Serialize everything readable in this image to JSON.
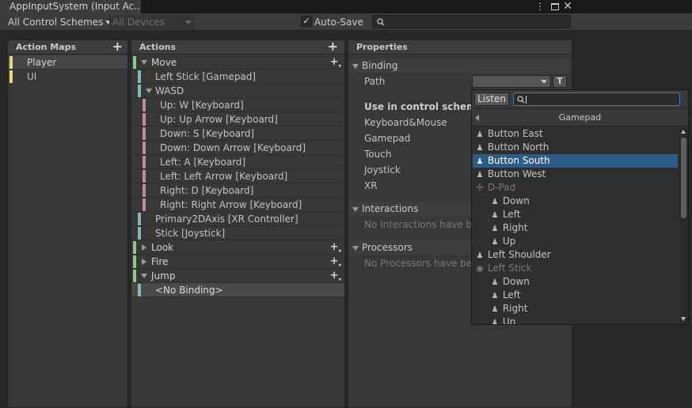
{
  "window": {
    "title": "AppInputSystem (Input Ac...",
    "menu_icon": "kebab-menu-icon",
    "maximize_icon": "maximize-icon",
    "close_icon": "close-icon"
  },
  "toolbar": {
    "control_schemes": "All Control Schemes",
    "devices": "All Devices",
    "autosave_checked": true,
    "autosave_label": "Auto-Save",
    "search_placeholder": ""
  },
  "action_maps": {
    "header": "Action Maps",
    "items": [
      {
        "label": "Player",
        "selected": true
      },
      {
        "label": "UI",
        "selected": false
      }
    ]
  },
  "actions": {
    "header": "Actions",
    "rows": [
      {
        "label": "Move",
        "kind": "action",
        "expanded": true
      },
      {
        "label": "Left Stick [Gamepad]",
        "kind": "binding"
      },
      {
        "label": "WASD",
        "kind": "composite",
        "expanded": true
      },
      {
        "label": "Up: W [Keyboard]",
        "kind": "part"
      },
      {
        "label": "Up: Up Arrow [Keyboard]",
        "kind": "part"
      },
      {
        "label": "Down: S [Keyboard]",
        "kind": "part"
      },
      {
        "label": "Down: Down Arrow [Keyboard]",
        "kind": "part"
      },
      {
        "label": "Left: A [Keyboard]",
        "kind": "part"
      },
      {
        "label": "Left: Left Arrow [Keyboard]",
        "kind": "part"
      },
      {
        "label": "Right: D [Keyboard]",
        "kind": "part"
      },
      {
        "label": "Right: Right Arrow [Keyboard]",
        "kind": "part"
      },
      {
        "label": "Primary2DAxis [XR Controller]",
        "kind": "binding"
      },
      {
        "label": "Stick [Joystick]",
        "kind": "binding"
      },
      {
        "label": "Look",
        "kind": "action",
        "expanded": false
      },
      {
        "label": "Fire",
        "kind": "action",
        "expanded": false
      },
      {
        "label": "Jump",
        "kind": "action",
        "expanded": true
      },
      {
        "label": "<No Binding>",
        "kind": "binding",
        "selected": true
      }
    ]
  },
  "properties": {
    "header": "Properties",
    "binding_section": "Binding",
    "path_label": "Path",
    "t_button": "T",
    "use_in_scheme": "Use in control scheme",
    "schemes": [
      "Keyboard&Mouse",
      "Gamepad",
      "Touch",
      "Joystick",
      "XR"
    ],
    "interactions_section": "Interactions",
    "interactions_empty": "No Interactions have bee",
    "processors_section": "Processors",
    "processors_empty": "No Processors have bee"
  },
  "popup": {
    "listen_label": "Listen",
    "search_value": "",
    "category": "Gamepad",
    "items": [
      {
        "label": "Button East",
        "icon": "person-icon",
        "indent": 0
      },
      {
        "label": "Button North",
        "icon": "person-icon",
        "indent": 0
      },
      {
        "label": "Button South",
        "icon": "person-icon",
        "indent": 0,
        "selected": true
      },
      {
        "label": "Button West",
        "icon": "person-icon",
        "indent": 0
      },
      {
        "label": "D-Pad",
        "icon": "dpad-icon",
        "indent": 0,
        "dim": true
      },
      {
        "label": "Down",
        "icon": "person-icon",
        "indent": 1
      },
      {
        "label": "Left",
        "icon": "person-icon",
        "indent": 1
      },
      {
        "label": "Right",
        "icon": "person-icon",
        "indent": 1
      },
      {
        "label": "Up",
        "icon": "person-icon",
        "indent": 1
      },
      {
        "label": "Left Shoulder",
        "icon": "person-icon",
        "indent": 0
      },
      {
        "label": "Left Stick",
        "icon": "stick-icon",
        "indent": 0,
        "dim": true
      },
      {
        "label": "Down",
        "icon": "person-icon",
        "indent": 1
      },
      {
        "label": "Left",
        "icon": "person-icon",
        "indent": 1
      },
      {
        "label": "Right",
        "icon": "person-icon",
        "indent": 1
      },
      {
        "label": "Up",
        "icon": "person-icon",
        "indent": 1
      }
    ]
  },
  "colors": {
    "map_bar": "#e8d77a",
    "action_bar": "#8fc98a",
    "binding_bar": "#89b7b6",
    "part_bar": "#c8879e",
    "selection": "#2c5d87"
  }
}
